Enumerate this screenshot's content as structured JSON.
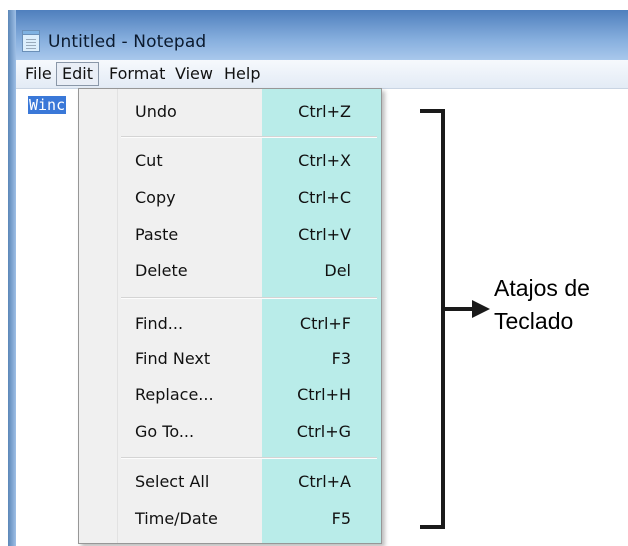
{
  "window": {
    "title": "Untitled - Notepad"
  },
  "menubar": {
    "items": [
      "File",
      "Edit",
      "Format",
      "View",
      "Help"
    ]
  },
  "editor": {
    "text": "Winc"
  },
  "edit_menu": {
    "items": [
      {
        "label": "Undo",
        "shortcut": "Ctrl+Z"
      },
      {
        "label": "Cut",
        "shortcut": "Ctrl+X"
      },
      {
        "label": "Copy",
        "shortcut": "Ctrl+C"
      },
      {
        "label": "Paste",
        "shortcut": "Ctrl+V"
      },
      {
        "label": "Delete",
        "shortcut": "Del"
      },
      {
        "label": "Find...",
        "shortcut": "Ctrl+F"
      },
      {
        "label": "Find Next",
        "shortcut": "F3"
      },
      {
        "label": "Replace...",
        "shortcut": "Ctrl+H"
      },
      {
        "label": "Go To...",
        "shortcut": "Ctrl+G"
      },
      {
        "label": "Select All",
        "shortcut": "Ctrl+A"
      },
      {
        "label": "Time/Date",
        "shortcut": "F5"
      }
    ]
  },
  "annotation": {
    "line1": "Atajos de",
    "line2": "Teclado"
  },
  "colors": {
    "shortcut_highlight": "#b9ece9",
    "selection": "#3a78d8",
    "titlebar": "#4f7fbd"
  }
}
